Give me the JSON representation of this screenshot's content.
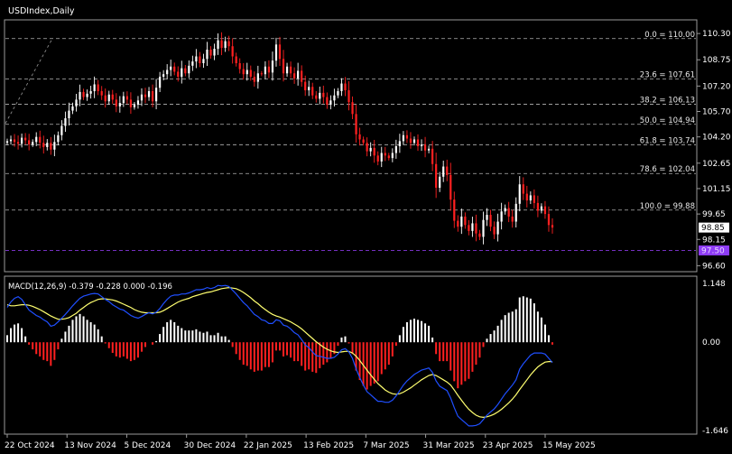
{
  "chart_data": {
    "type": "candlestick",
    "title": "USDIndex,Daily",
    "price_axis": {
      "ticks": [
        "110.30",
        "108.75",
        "107.20",
        "105.70",
        "104.20",
        "102.65",
        "101.15",
        "99.65",
        "98.15",
        "96.60"
      ],
      "ylim": [
        96.3,
        111.0
      ]
    },
    "x_ticks": [
      "22 Oct 2024",
      "13 Nov 2024",
      "5 Dec 2024",
      "30 Dec 2024",
      "22 Jan 2025",
      "13 Feb 2025",
      "7 Mar 2025",
      "31 Mar 2025",
      "23 Apr 2025",
      "15 May 2025"
    ],
    "current_price": "98.85",
    "purple_line_price": "97.50",
    "fib_levels": [
      {
        "label": "0.0 = 110.00",
        "price": 110.0
      },
      {
        "label": "23.6 = 107.61",
        "price": 107.61
      },
      {
        "label": "38.2 = 106.13",
        "price": 106.13
      },
      {
        "label": "50.0 = 104.94",
        "price": 104.94
      },
      {
        "label": "61.8 = 103.74",
        "price": 103.74
      },
      {
        "label": "78.6 = 102.04",
        "price": 102.04
      },
      {
        "label": "100.0 = 99.88",
        "price": 99.88
      }
    ],
    "closes": [
      103.95,
      104.05,
      103.9,
      103.8,
      104.15,
      104.0,
      103.75,
      103.9,
      104.2,
      103.85,
      103.6,
      103.85,
      103.45,
      103.9,
      104.3,
      104.85,
      105.3,
      105.75,
      106.0,
      106.4,
      106.85,
      106.55,
      106.75,
      106.9,
      107.3,
      106.9,
      106.65,
      106.3,
      106.7,
      106.4,
      106.0,
      106.2,
      106.6,
      106.4,
      105.95,
      106.1,
      106.35,
      106.7,
      106.55,
      106.9,
      106.3,
      107.1,
      107.75,
      107.9,
      108.15,
      108.35,
      108.05,
      107.75,
      108.25,
      107.95,
      108.4,
      108.65,
      108.95,
      108.55,
      108.8,
      109.35,
      109.0,
      109.4,
      109.9,
      109.45,
      109.85,
      109.55,
      108.95,
      108.55,
      108.2,
      107.9,
      108.15,
      107.75,
      107.45,
      107.95,
      107.9,
      108.35,
      108.0,
      108.7,
      109.65,
      108.8,
      107.95,
      108.35,
      107.95,
      107.65,
      108.1,
      107.45,
      106.95,
      107.15,
      106.65,
      106.45,
      106.8,
      106.55,
      106.1,
      106.35,
      106.65,
      106.9,
      107.35,
      106.95,
      106.25,
      105.55,
      104.35,
      104.05,
      103.85,
      103.35,
      103.55,
      103.1,
      102.75,
      103.25,
      103.1,
      102.95,
      103.25,
      103.65,
      103.95,
      104.3,
      104.1,
      103.85,
      104.05,
      103.65,
      103.75,
      103.4,
      103.5,
      102.6,
      101.2,
      101.85,
      102.45,
      101.95,
      100.5,
      99.25,
      98.9,
      99.5,
      99.0,
      98.65,
      99.1,
      98.5,
      98.3,
      99.3,
      99.6,
      98.9,
      98.45,
      99.2,
      99.8,
      100.0,
      99.5,
      99.2,
      100.25,
      101.4,
      100.85,
      100.45,
      100.75,
      100.3,
      99.85,
      100.1,
      99.65,
      99.0,
      98.85
    ],
    "macd": {
      "label": "MACD(12,26,9) -0.379 -0.228 0.000 -0.196",
      "ticks": [
        "1.148",
        "0.00",
        "-1.646"
      ],
      "ylim": [
        -1.646,
        1.148
      ],
      "macd_line": [
        0.65,
        0.75,
        0.82,
        0.85,
        0.8,
        0.7,
        0.6,
        0.55,
        0.5,
        0.47,
        0.42,
        0.38,
        0.3,
        0.32,
        0.38,
        0.45,
        0.52,
        0.6,
        0.68,
        0.75,
        0.82,
        0.86,
        0.88,
        0.9,
        0.91,
        0.9,
        0.85,
        0.8,
        0.76,
        0.7,
        0.66,
        0.62,
        0.6,
        0.55,
        0.5,
        0.47,
        0.45,
        0.48,
        0.52,
        0.55,
        0.53,
        0.56,
        0.63,
        0.72,
        0.8,
        0.86,
        0.88,
        0.88,
        0.9,
        0.9,
        0.92,
        0.95,
        0.98,
        0.98,
        0.99,
        1.02,
        1.0,
        1.02,
        1.06,
        1.05,
        1.06,
        1.04,
        0.97,
        0.9,
        0.82,
        0.74,
        0.68,
        0.6,
        0.52,
        0.48,
        0.42,
        0.4,
        0.35,
        0.35,
        0.42,
        0.4,
        0.32,
        0.3,
        0.25,
        0.18,
        0.14,
        0.05,
        -0.05,
        -0.1,
        -0.18,
        -0.25,
        -0.26,
        -0.28,
        -0.3,
        -0.3,
        -0.28,
        -0.22,
        -0.14,
        -0.12,
        -0.18,
        -0.3,
        -0.5,
        -0.66,
        -0.8,
        -0.92,
        -0.98,
        -1.04,
        -1.1,
        -1.1,
        -1.12,
        -1.12,
        -1.08,
        -1.0,
        -0.9,
        -0.8,
        -0.72,
        -0.66,
        -0.6,
        -0.56,
        -0.52,
        -0.5,
        -0.48,
        -0.56,
        -0.72,
        -0.82,
        -0.86,
        -0.9,
        -1.04,
        -1.22,
        -1.38,
        -1.44,
        -1.5,
        -1.56,
        -1.56,
        -1.55,
        -1.52,
        -1.44,
        -1.36,
        -1.3,
        -1.24,
        -1.16,
        -1.06,
        -0.96,
        -0.88,
        -0.8,
        -0.7,
        -0.5,
        -0.4,
        -0.32,
        -0.24,
        -0.2,
        -0.2,
        -0.2,
        -0.22,
        -0.3,
        -0.38
      ],
      "signal_line": [
        0.7,
        0.68,
        0.68,
        0.69,
        0.7,
        0.7,
        0.69,
        0.67,
        0.64,
        0.61,
        0.57,
        0.53,
        0.49,
        0.46,
        0.43,
        0.43,
        0.44,
        0.46,
        0.5,
        0.54,
        0.6,
        0.65,
        0.7,
        0.74,
        0.77,
        0.8,
        0.81,
        0.81,
        0.8,
        0.79,
        0.77,
        0.74,
        0.71,
        0.68,
        0.65,
        0.61,
        0.58,
        0.56,
        0.55,
        0.55,
        0.55,
        0.55,
        0.56,
        0.59,
        0.63,
        0.67,
        0.71,
        0.75,
        0.78,
        0.8,
        0.82,
        0.85,
        0.87,
        0.89,
        0.91,
        0.93,
        0.94,
        0.96,
        0.98,
        1.0,
        1.01,
        1.02,
        1.01,
        1.0,
        0.97,
        0.93,
        0.88,
        0.83,
        0.77,
        0.72,
        0.66,
        0.61,
        0.56,
        0.52,
        0.49,
        0.47,
        0.44,
        0.41,
        0.38,
        0.34,
        0.3,
        0.25,
        0.19,
        0.13,
        0.07,
        0.01,
        -0.04,
        -0.09,
        -0.13,
        -0.16,
        -0.18,
        -0.19,
        -0.18,
        -0.17,
        -0.17,
        -0.2,
        -0.26,
        -0.34,
        -0.43,
        -0.52,
        -0.61,
        -0.69,
        -0.77,
        -0.83,
        -0.89,
        -0.93,
        -0.96,
        -0.97,
        -0.96,
        -0.93,
        -0.89,
        -0.85,
        -0.8,
        -0.75,
        -0.7,
        -0.66,
        -0.62,
        -0.6,
        -0.62,
        -0.66,
        -0.7,
        -0.74,
        -0.8,
        -0.89,
        -0.99,
        -1.08,
        -1.17,
        -1.25,
        -1.31,
        -1.36,
        -1.39,
        -1.4,
        -1.39,
        -1.37,
        -1.34,
        -1.3,
        -1.25,
        -1.19,
        -1.13,
        -1.06,
        -0.98,
        -0.88,
        -0.79,
        -0.7,
        -0.61,
        -0.53,
        -0.46,
        -0.41,
        -0.37,
        -0.36,
        -0.36
      ],
      "histogram": [
        0.06,
        0.12,
        0.15,
        0.16,
        0.12,
        0.05,
        -0.02,
        -0.06,
        -0.1,
        -0.12,
        -0.15,
        -0.16,
        -0.2,
        -0.15,
        -0.06,
        0.03,
        0.09,
        0.14,
        0.19,
        0.22,
        0.24,
        0.22,
        0.19,
        0.17,
        0.15,
        0.11,
        0.05,
        -0.01,
        -0.05,
        -0.09,
        -0.12,
        -0.13,
        -0.12,
        -0.14,
        -0.16,
        -0.15,
        -0.13,
        -0.08,
        -0.04,
        0.0,
        -0.02,
        0.01,
        0.07,
        0.13,
        0.17,
        0.19,
        0.17,
        0.14,
        0.12,
        0.1,
        0.1,
        0.1,
        0.11,
        0.09,
        0.08,
        0.09,
        0.06,
        0.06,
        0.08,
        0.05,
        0.05,
        0.02,
        -0.04,
        -0.1,
        -0.15,
        -0.19,
        -0.2,
        -0.23,
        -0.25,
        -0.24,
        -0.24,
        -0.21,
        -0.21,
        -0.17,
        -0.07,
        -0.07,
        -0.12,
        -0.11,
        -0.13,
        -0.16,
        -0.16,
        -0.2,
        -0.24,
        -0.23,
        -0.25,
        -0.26,
        -0.22,
        -0.19,
        -0.17,
        -0.14,
        -0.1,
        -0.03,
        0.04,
        0.05,
        -0.01,
        -0.1,
        -0.24,
        -0.32,
        -0.37,
        -0.4,
        -0.37,
        -0.35,
        -0.33,
        -0.27,
        -0.23,
        -0.19,
        -0.12,
        -0.03,
        0.06,
        0.13,
        0.17,
        0.19,
        0.2,
        0.19,
        0.18,
        0.16,
        0.14,
        0.04,
        -0.1,
        -0.16,
        -0.16,
        -0.16,
        -0.24,
        -0.33,
        -0.39,
        -0.36,
        -0.33,
        -0.31,
        -0.25,
        -0.19,
        -0.13,
        -0.04,
        0.03,
        0.07,
        0.1,
        0.14,
        0.19,
        0.23,
        0.25,
        0.26,
        0.28,
        0.38,
        0.39,
        0.38,
        0.37,
        0.33,
        0.26,
        0.21,
        0.15,
        0.06,
        -0.02
      ]
    },
    "colors": {
      "background": "#000000",
      "bull_candle": "#ffffff",
      "bear_candle": "#ff2020",
      "grid_line": "#b4b4b4",
      "macd_line": "#1f4fff",
      "signal_line": "#ffff70",
      "hist_positive": "#ffffff",
      "hist_negative": "#ff2020",
      "purple_line": "#9a40ff",
      "price_box": "#ffffff",
      "purple_box": "#8e3cf5",
      "trend_line": "#8c8c8c"
    }
  }
}
